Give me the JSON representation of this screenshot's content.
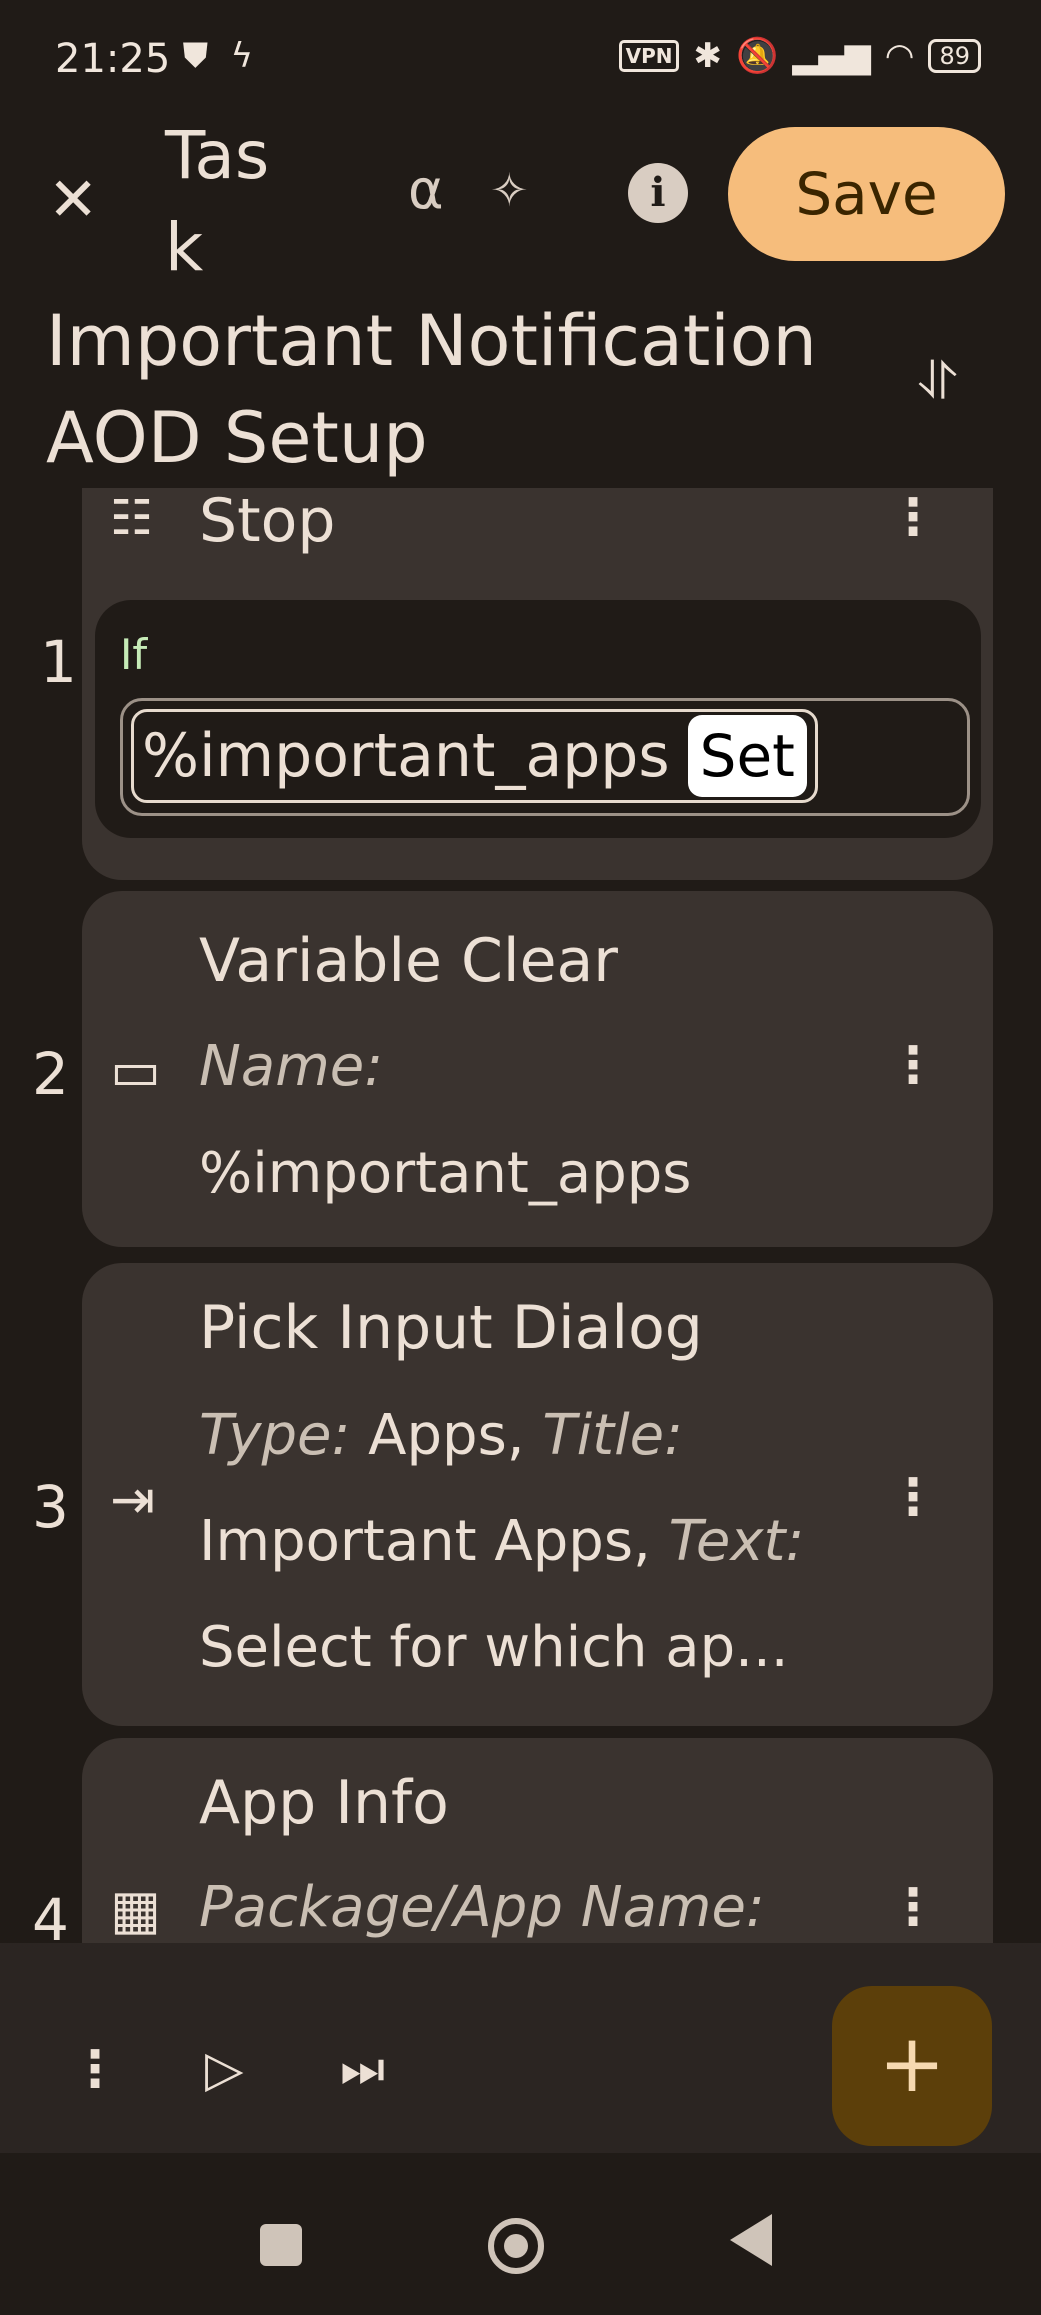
{
  "status_bar": {
    "time": "21:25",
    "vpn": "VPN",
    "battery": "89"
  },
  "top_bar": {
    "close_glyph": "✕",
    "task_label": "Task",
    "alpha_glyph": "α",
    "sparkle_glyph": "✧",
    "info_glyph": "i",
    "save_label": "Save",
    "collapse_glyph": "⥯"
  },
  "task_name": "Important Notification AOD Setup",
  "actions": [
    {
      "number": "1",
      "title": "Stop",
      "if_label": "If",
      "variable": "%important_apps",
      "condition": "Set"
    },
    {
      "number": "2",
      "title": "Variable Clear",
      "params": [
        {
          "label": "Name:",
          "value": ""
        },
        {
          "label": "",
          "value": "%important_apps"
        }
      ]
    },
    {
      "number": "3",
      "title": "Pick Input Dialog",
      "line1_label1": "Type:",
      "line1_value1": "Apps,",
      "line1_label2": "Title:",
      "line2_value": "Important Apps,",
      "line2_label": "Text:",
      "line3_value": "Select for which ap..."
    },
    {
      "number": "4",
      "title": "App Info",
      "param_label": "Package/App Name:"
    }
  ],
  "bottom_bar": {
    "more_glyph": "⋮",
    "play_glyph": "▷",
    "step_glyph": "⏭",
    "add_glyph": "+"
  },
  "icons": [
    "close-icon",
    "alpha-icon",
    "sparkle-icon",
    "info-icon",
    "collapse-icon",
    "list-icon",
    "label-icon",
    "input-icon",
    "apps-icon",
    "more-icon",
    "play-icon",
    "step-icon",
    "add-icon"
  ]
}
